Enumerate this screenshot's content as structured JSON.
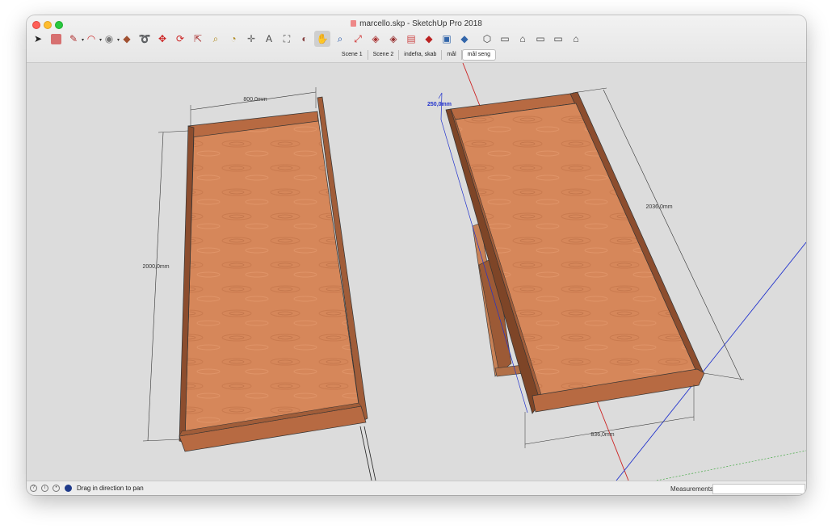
{
  "window": {
    "title": "marcello.skp - SketchUp Pro 2018"
  },
  "toolbar": {
    "tools": [
      {
        "name": "select-tool-icon",
        "glyph": "➤",
        "color": "#222222"
      },
      {
        "name": "eraser-tool-icon",
        "glyph": "",
        "color": "#d77070"
      },
      {
        "name": "line-tool-icon",
        "glyph": "✎",
        "color": "#b03030",
        "dropdown": true
      },
      {
        "name": "arc-tool-icon",
        "glyph": "◠",
        "color": "#cc3333",
        "dropdown": true
      },
      {
        "name": "shape-tool-icon",
        "glyph": "◉",
        "color": "#777777",
        "dropdown": true
      },
      {
        "name": "push-pull-tool-icon",
        "glyph": "◆",
        "color": "#a05030"
      },
      {
        "name": "follow-me-tool-icon",
        "glyph": "➰",
        "color": "#cc3333"
      },
      {
        "name": "move-tool-icon",
        "glyph": "✥",
        "color": "#cc2222"
      },
      {
        "name": "rotate-tool-icon",
        "glyph": "⟳",
        "color": "#cc2222"
      },
      {
        "name": "scale-tool-icon",
        "glyph": "⇱",
        "color": "#aa3333"
      },
      {
        "name": "tape-measure-tool-icon",
        "glyph": "⌕",
        "color": "#b08a20"
      },
      {
        "name": "protractor-tool-icon",
        "glyph": "◔",
        "color": "#b08a20"
      },
      {
        "name": "axes-tool-icon",
        "glyph": "✛",
        "color": "#666666"
      },
      {
        "name": "text-tool-icon",
        "glyph": "A",
        "color": "#444444"
      },
      {
        "name": "paint-bucket-tool-icon",
        "glyph": "⛶",
        "color": "#555555"
      },
      {
        "name": "orbit-tool-icon",
        "glyph": "◐",
        "color": "#884444"
      },
      {
        "name": "pan-tool-icon",
        "glyph": "✋",
        "color": "#c9a36b",
        "active": true
      },
      {
        "name": "zoom-tool-icon",
        "glyph": "⌕",
        "color": "#2255aa"
      },
      {
        "name": "zoom-extents-tool-icon",
        "glyph": "⤢",
        "color": "#cc2222"
      },
      {
        "name": "warehouse-tool-icon",
        "glyph": "◈",
        "color": "#aa3333"
      },
      {
        "name": "share-model-tool-icon",
        "glyph": "◈",
        "color": "#993333"
      },
      {
        "name": "extension-tool-icon",
        "glyph": "▤",
        "color": "#cc4444"
      },
      {
        "name": "ruby-tool-icon",
        "glyph": "◆",
        "color": "#bb2222"
      },
      {
        "name": "layout-tool-icon",
        "glyph": "▣",
        "color": "#3366aa"
      },
      {
        "name": "style-builder-tool-icon",
        "glyph": "◆",
        "color": "#3366aa"
      },
      {
        "name": "iso-view-icon",
        "glyph": "⬡",
        "color": "#444444"
      },
      {
        "name": "top-view-icon",
        "glyph": "▭",
        "color": "#444444"
      },
      {
        "name": "front-view-icon",
        "glyph": "⌂",
        "color": "#444444"
      },
      {
        "name": "right-view-icon",
        "glyph": "▭",
        "color": "#444444"
      },
      {
        "name": "back-view-icon",
        "glyph": "▭",
        "color": "#444444"
      },
      {
        "name": "home-view-icon",
        "glyph": "⌂",
        "color": "#444444"
      }
    ]
  },
  "scenes": {
    "tabs": [
      "Scene 1",
      "Scene 2",
      "indefra, skab",
      "mål",
      "mål seng"
    ],
    "selected": "mål seng"
  },
  "viewport": {
    "dimensions": {
      "width_left": "800,0mm",
      "length_left": "2000,0mm",
      "height_right": "250,0mm",
      "length_right": "2036,0mm",
      "width_right": "836,0mm"
    },
    "colors": {
      "background": "#dcdcdc",
      "wood_surface": "#d6875a",
      "wood_edge": "#a15d39",
      "wood_dark": "#7e4527",
      "axis_red": "#cc2222",
      "axis_blue": "#2233cc",
      "axis_green": "#44aa44"
    }
  },
  "status": {
    "message": "Drag in direction to pan",
    "measurements_label": "Measurements",
    "measurements_value": ""
  }
}
